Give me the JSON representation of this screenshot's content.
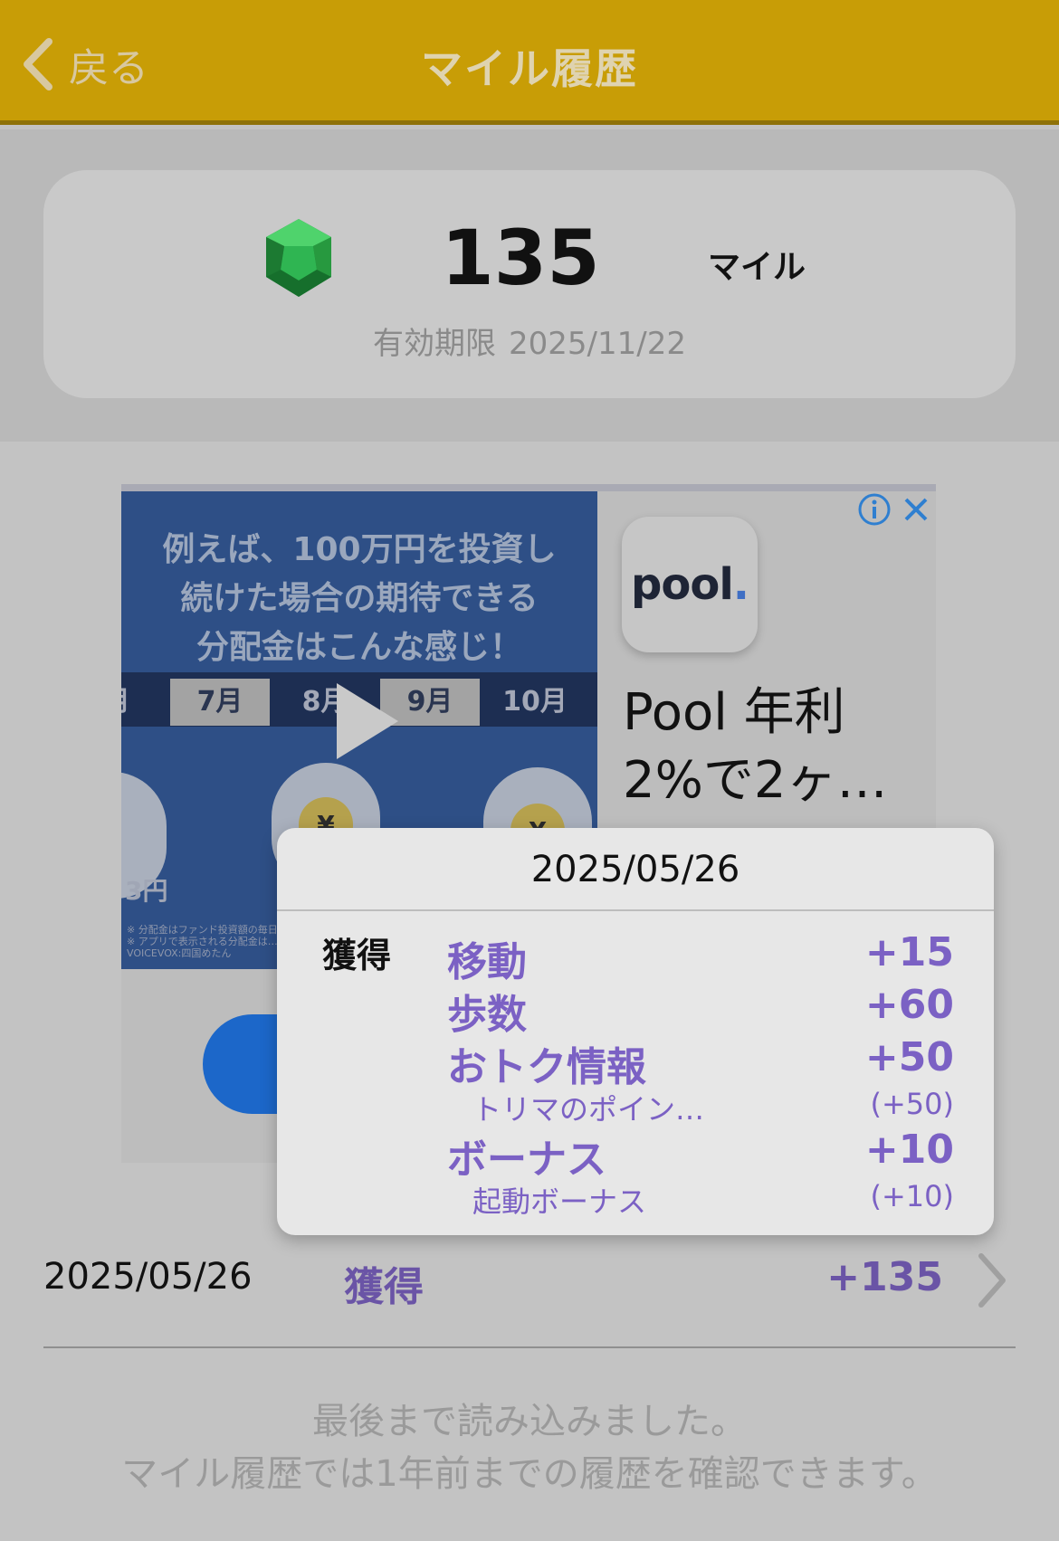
{
  "header": {
    "back_label": "戻る",
    "title": "マイル履歴",
    "background_color": "#c89d06"
  },
  "summary": {
    "icon": "green-gem-icon",
    "miles": "135",
    "unit": "マイル",
    "expiry_label": "有効期限",
    "expiry_date": "2025/11/22"
  },
  "ad": {
    "video_text": "例えば、100万円を投資し\n続けた場合の期待できる\n分配金はこんな感じ！",
    "months": [
      "月",
      "7月",
      "8月",
      "9月",
      "10月"
    ],
    "amount_fragment": "3円",
    "bag_symbol": "¥",
    "fine_print": "※ 分配金はファンド投資額の毎日の…\n※ アプリで表示される分配金は…\nVOICEVOX:四国めたん",
    "app_name": "pool",
    "headline": "Pool 年利 2%で2ヶ…",
    "info_icon": "info-icon",
    "close_icon": "close-icon"
  },
  "popover": {
    "date": "2025/05/26",
    "label": "獲得",
    "items": [
      {
        "name": "移動",
        "value": "+15"
      },
      {
        "name": "歩数",
        "value": "+60"
      },
      {
        "name": "おトク情報",
        "value": "+50"
      },
      {
        "name": "トリマのポイン…",
        "value": "(+50)"
      },
      {
        "name": "ボーナス",
        "value": "+10"
      },
      {
        "name": "起動ボーナス",
        "value": "(+10)"
      }
    ]
  },
  "history": [
    {
      "date": "2025/05/26",
      "type": "獲得",
      "amount": "+135"
    }
  ],
  "footer": {
    "line1": "最後まで読み込みました。",
    "line2": "マイル履歴では1年前までの履歴を確認できます。"
  },
  "colors": {
    "accent_purple": "#6a54a6",
    "popover_purple": "#7b61c4"
  }
}
